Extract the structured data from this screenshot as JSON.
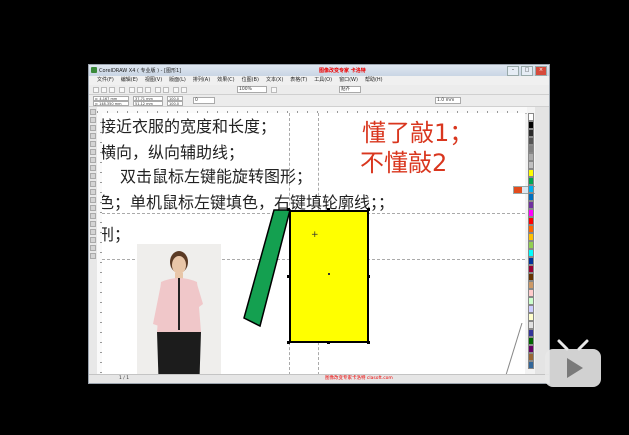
{
  "window": {
    "title": "CorelDRAW X4 ( 专业版 ) - [图形1]",
    "watermark": "图像改变专家 卡洛特"
  },
  "menubar": [
    "文件(F)",
    "编辑(E)",
    "视图(V)",
    "版面(L)",
    "排列(A)",
    "效果(C)",
    "位图(B)",
    "文本(X)",
    "表格(T)",
    "工具(O)",
    "窗口(W)",
    "帮助(H)"
  ],
  "toolbar": {
    "zoom": "100%",
    "snap_label": "贴齐",
    "x_label": "x: 4.167 mm",
    "y_label": "y: 148.350 mm",
    "w_label": "37.71 mm",
    "h_label": "51.12 mm",
    "w_pct": "100.0",
    "h_pct": "100.0",
    "rotation": "0",
    "outline": "1.0 mm"
  },
  "canvas": {
    "line1": "接近衣服的宽度和长度；",
    "line2": "横向，纵向辅助线；",
    "line3": "双击鼠标左键能旋转图形；",
    "line4": "色；单机鼠标左键填色，右键填轮廓线；；",
    "line5": "刑；",
    "hint_line1": "懂了敲1；",
    "hint_line2": "不懂敲2"
  },
  "statusbar": {
    "page": "1 / 1",
    "site": "图像改变专家卡洛特 clasoft.com"
  },
  "colors": {
    "yellow_fill": "#ffff00",
    "green_fill": "#14a050",
    "hint_red": "#d9361e"
  },
  "palette": [
    "#ffffff",
    "#000000",
    "#2a2a2a",
    "#555555",
    "#808080",
    "#aaaaaa",
    "#c0c0c0",
    "#ffff00",
    "#00a651",
    "#00b0f0",
    "#0070c0",
    "#7030a0",
    "#ff00ff",
    "#ff0000",
    "#ff6600",
    "#ffc000",
    "#92d050",
    "#00ffff",
    "#003399",
    "#990033",
    "#663300",
    "#cc9966",
    "#ffcccc",
    "#ccffcc",
    "#ccccff",
    "#ffffcc",
    "#e0e0e0",
    "#333399",
    "#006600",
    "#660066",
    "#996633",
    "#336699"
  ]
}
